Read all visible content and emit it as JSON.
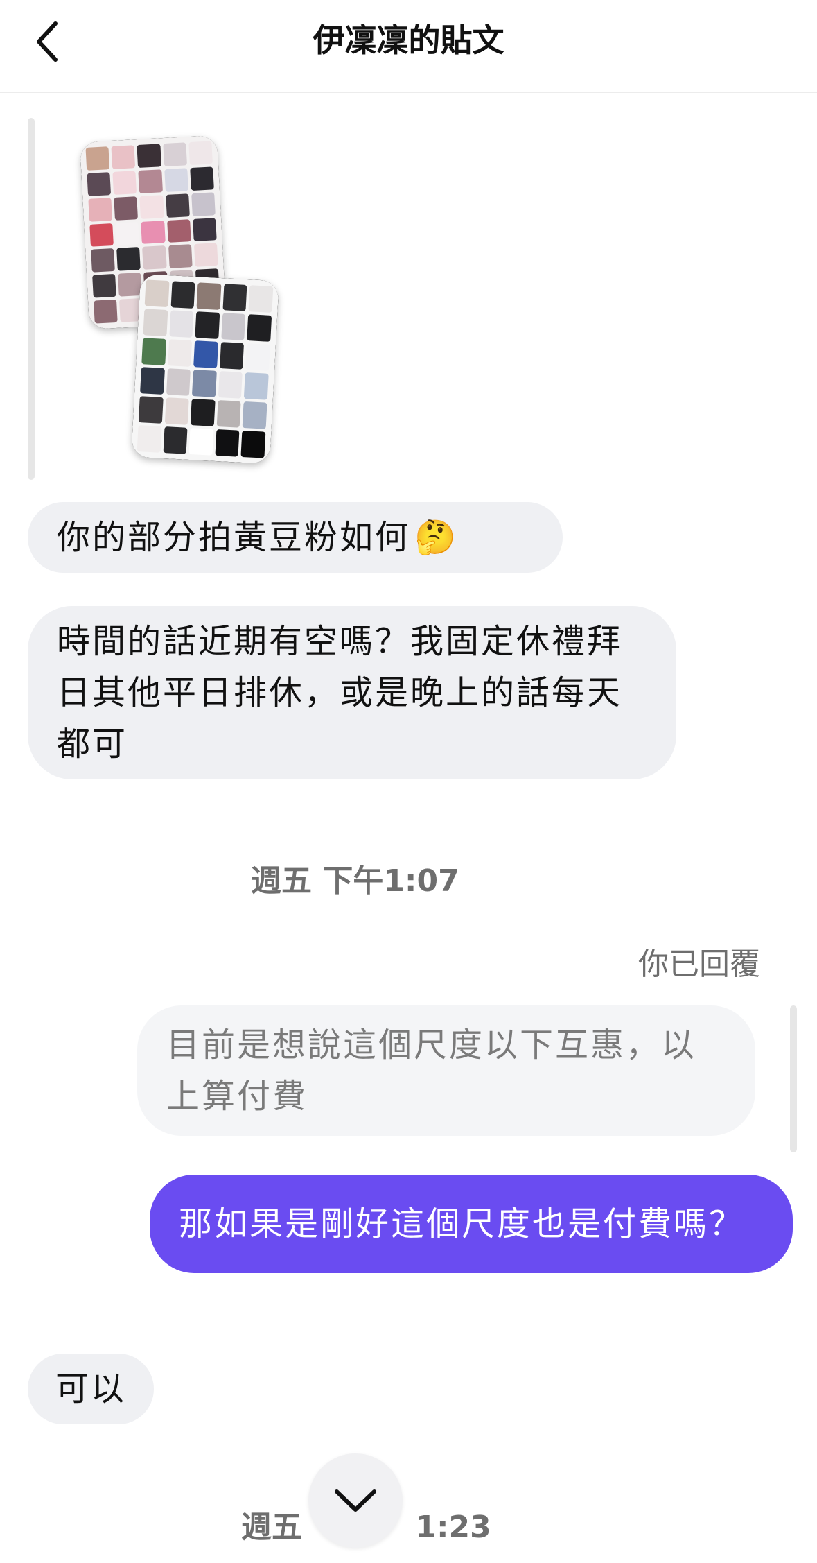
{
  "header": {
    "title": "伊凜凜的貼文",
    "back_icon": "chevron-left-icon"
  },
  "messages": {
    "m1": "你的部分拍黃豆粉如何",
    "m1_emoji": "🤔",
    "m2": "時間的話近期有空嗎？我固定休禮拜日其他平日排休，或是晚上的話每天都可",
    "time1": "週五 下午1:07",
    "replied_label": "你已回覆",
    "quoted_reply": "目前是想說這個尺度以下互惠，以上算付費",
    "sent": "那如果是剛好這個尺度也是付費嗎？",
    "m3": "可以",
    "time2_a": "週五",
    "time2_b": "1:23"
  },
  "colors": {
    "accent": "#6a4cf1",
    "incoming_bubble": "#eff0f3",
    "quoted_bubble": "#f4f5f7"
  },
  "icons": {
    "scroll_down": "chevron-down-icon"
  }
}
